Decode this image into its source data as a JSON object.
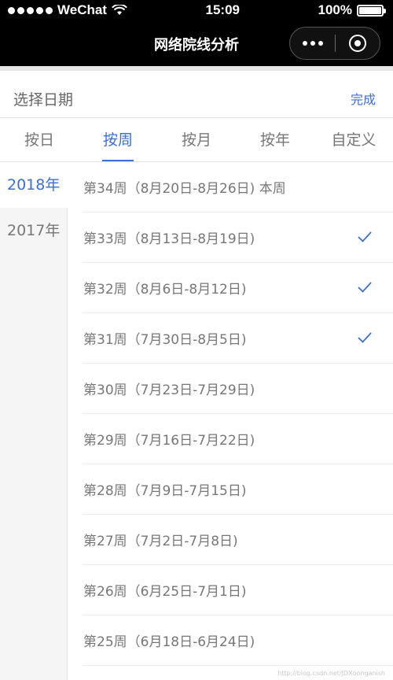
{
  "status_bar": {
    "carrier": "WeChat",
    "time": "15:09",
    "battery": "100%"
  },
  "nav": {
    "title": "网络院线分析"
  },
  "picker": {
    "title": "选择日期",
    "done_label": "完成"
  },
  "tabs": [
    {
      "label": "按日",
      "active": false
    },
    {
      "label": "按周",
      "active": true
    },
    {
      "label": "按月",
      "active": false
    },
    {
      "label": "按年",
      "active": false
    },
    {
      "label": "自定义",
      "active": false
    }
  ],
  "years": [
    {
      "label": "2018年",
      "active": true
    },
    {
      "label": "2017年",
      "active": false
    }
  ],
  "weeks": [
    {
      "label": "第34周（8月20日-8月26日) 本周",
      "checked": false
    },
    {
      "label": "第33周（8月13日-8月19日)",
      "checked": true
    },
    {
      "label": "第32周（8月6日-8月12日)",
      "checked": true
    },
    {
      "label": "第31周（7月30日-8月5日)",
      "checked": true
    },
    {
      "label": "第30周（7月23日-7月29日)",
      "checked": false
    },
    {
      "label": "第29周（7月16日-7月22日)",
      "checked": false
    },
    {
      "label": "第28周（7月9日-7月15日)",
      "checked": false
    },
    {
      "label": "第27周（7月2日-7月8日)",
      "checked": false
    },
    {
      "label": "第26周（6月25日-7月1日)",
      "checked": false
    },
    {
      "label": "第25周（6月18日-6月24日)",
      "checked": false
    }
  ],
  "watermark": "http://blog.csdn.net/JDXoonganish",
  "colors": {
    "accent": "#3a6fd8",
    "text": "#777777"
  }
}
